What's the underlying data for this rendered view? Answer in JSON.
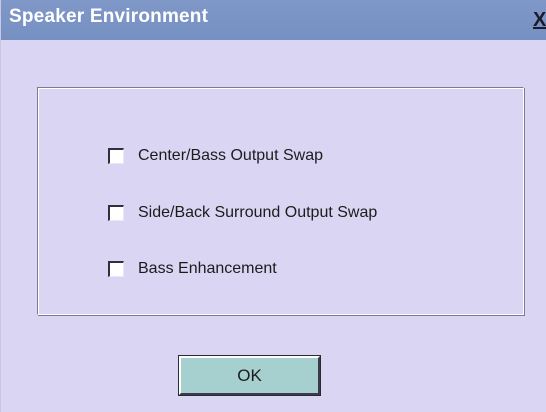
{
  "window": {
    "title": "Speaker Environment",
    "close_label": "X"
  },
  "options": [
    {
      "label": "Center/Bass Output Swap",
      "checked": false
    },
    {
      "label": "Side/Back Surround Output Swap",
      "checked": false
    },
    {
      "label": "Bass Enhancement",
      "checked": false
    }
  ],
  "buttons": {
    "ok_label": "OK"
  },
  "colors": {
    "titlebar": "#7690c2",
    "dialog_bg": "#d9d5f3",
    "ok_button_bg": "#a6cfd0"
  }
}
